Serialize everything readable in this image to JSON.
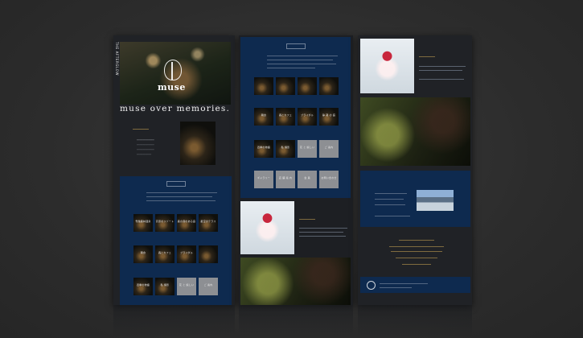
{
  "hero": {
    "brand_logo": "muse",
    "vertical_tagline": "THE AFTERGLOW",
    "headline": "muse over memories."
  },
  "sections": {
    "col1_thumb_caps": [
      "雪融森林温泉",
      "高原のリゾート",
      "森の音のある庭",
      "星空のテラス"
    ],
    "col1_row2_caps": [
      "朝食",
      "森とカフェ",
      "ブライダル"
    ],
    "col1_row3_caps": [
      "四季の物語",
      "私 撮影",
      "花 と 嬉しい",
      "ご 案内"
    ],
    "col2_row2_caps": [
      "朝食",
      "森とカフェ",
      "ブライダル",
      "静 寂 の 庭"
    ],
    "col2_row3_caps": [
      "四季の物語",
      "私 撮影",
      "花 と 嬉しい",
      "ご 案内"
    ],
    "col2_row4_caps": [
      "ギャラリー",
      "店 舗 案 内",
      "会 員",
      "お問い合わせ"
    ]
  },
  "colors": {
    "navy": "#0e2a4f",
    "gold": "#c4a063",
    "page_bg": "#2e2e2e"
  }
}
